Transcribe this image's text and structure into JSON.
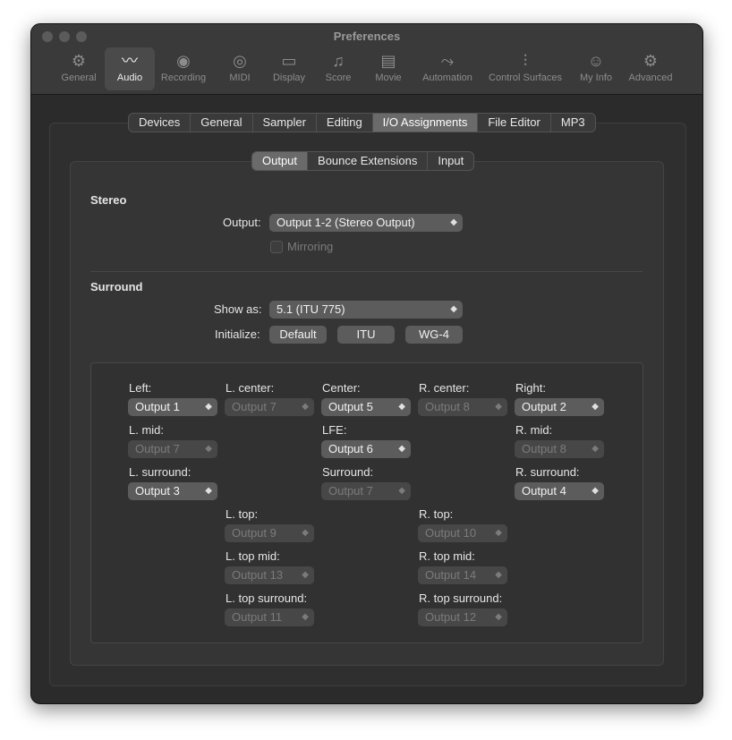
{
  "window": {
    "title": "Preferences"
  },
  "toolbar": {
    "items": [
      {
        "label": "General",
        "icon": "gear-icon",
        "glyph": "⚙"
      },
      {
        "label": "Audio",
        "icon": "waveform-icon",
        "glyph": "〰"
      },
      {
        "label": "Recording",
        "icon": "record-icon",
        "glyph": "◉"
      },
      {
        "label": "MIDI",
        "icon": "midi-connector-icon",
        "glyph": "◎"
      },
      {
        "label": "Display",
        "icon": "monitor-icon",
        "glyph": "▭"
      },
      {
        "label": "Score",
        "icon": "music-notes-icon",
        "glyph": "♫"
      },
      {
        "label": "Movie",
        "icon": "film-icon",
        "glyph": "▤"
      },
      {
        "label": "Automation",
        "icon": "automation-curve-icon",
        "glyph": "⤳"
      },
      {
        "label": "Control Surfaces",
        "icon": "faders-icon",
        "glyph": "⫶"
      },
      {
        "label": "My Info",
        "icon": "person-icon",
        "glyph": "☺"
      },
      {
        "label": "Advanced",
        "icon": "gears-icon",
        "glyph": "⚙"
      }
    ]
  },
  "tabs": [
    "Devices",
    "General",
    "Sampler",
    "Editing",
    "I/O Assignments",
    "File Editor",
    "MP3"
  ],
  "subtabs": [
    "Output",
    "Bounce Extensions",
    "Input"
  ],
  "stereo": {
    "heading": "Stereo",
    "output_label": "Output:",
    "output_value": "Output 1-2 (Stereo Output)",
    "mirroring_label": "Mirroring"
  },
  "surround": {
    "heading": "Surround",
    "show_as_label": "Show as:",
    "show_as_value": "5.1 (ITU 775)",
    "initialize_label": "Initialize:",
    "buttons": [
      "Default",
      "ITU",
      "WG-4"
    ]
  },
  "channels": {
    "left": {
      "label": "Left:",
      "value": "Output 1"
    },
    "l_center": {
      "label": "L. center:",
      "value": "Output 7"
    },
    "center": {
      "label": "Center:",
      "value": "Output 5"
    },
    "r_center": {
      "label": "R. center:",
      "value": "Output 8"
    },
    "right": {
      "label": "Right:",
      "value": "Output 2"
    },
    "l_mid": {
      "label": "L. mid:",
      "value": "Output 7"
    },
    "lfe": {
      "label": "LFE:",
      "value": "Output 6"
    },
    "r_mid": {
      "label": "R. mid:",
      "value": "Output 8"
    },
    "l_surround": {
      "label": "L. surround:",
      "value": "Output 3"
    },
    "surround": {
      "label": "Surround:",
      "value": "Output 7"
    },
    "r_surround": {
      "label": "R. surround:",
      "value": "Output 4"
    },
    "l_top": {
      "label": "L. top:",
      "value": "Output 9"
    },
    "r_top": {
      "label": "R. top:",
      "value": "Output 10"
    },
    "l_top_mid": {
      "label": "L. top mid:",
      "value": "Output 13"
    },
    "r_top_mid": {
      "label": "R. top mid:",
      "value": "Output 14"
    },
    "l_top_surround": {
      "label": "L. top surround:",
      "value": "Output 11"
    },
    "r_top_surround": {
      "label": "R. top surround:",
      "value": "Output 12"
    }
  }
}
